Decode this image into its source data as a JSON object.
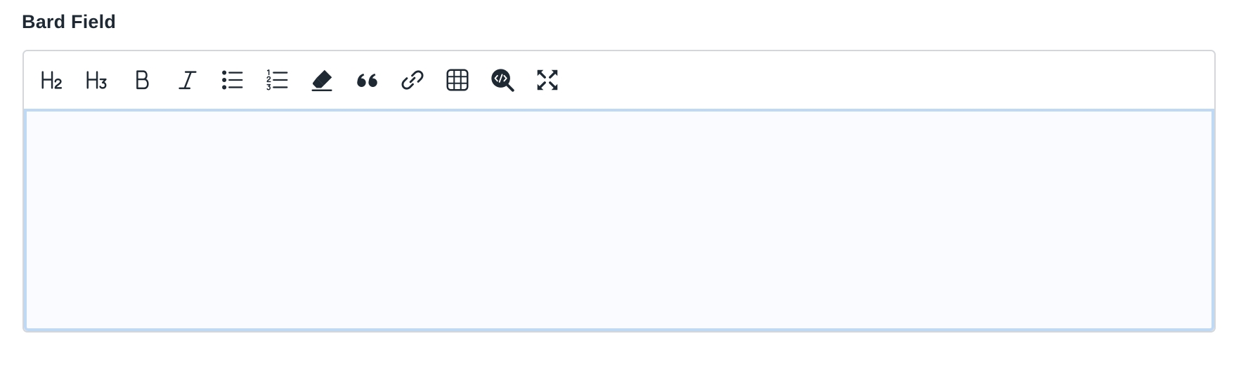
{
  "field": {
    "label": "Bard Field",
    "content": ""
  },
  "toolbar": {
    "buttons": [
      {
        "name": "heading-2",
        "icon": "h2-icon"
      },
      {
        "name": "heading-3",
        "icon": "h3-icon"
      },
      {
        "name": "bold",
        "icon": "bold-icon"
      },
      {
        "name": "italic",
        "icon": "italic-icon"
      },
      {
        "name": "unordered-list",
        "icon": "bullet-list-icon"
      },
      {
        "name": "ordered-list",
        "icon": "numbered-list-icon"
      },
      {
        "name": "remove-format",
        "icon": "eraser-icon"
      },
      {
        "name": "blockquote",
        "icon": "quote-icon"
      },
      {
        "name": "link",
        "icon": "link-icon"
      },
      {
        "name": "table",
        "icon": "table-icon"
      },
      {
        "name": "view-source",
        "icon": "code-search-icon"
      },
      {
        "name": "fullscreen",
        "icon": "expand-icon"
      }
    ]
  },
  "colors": {
    "text": "#1f2933",
    "border": "#d3d6da",
    "focus_border": "#bfd8f3",
    "content_bg": "#f9fbfe"
  }
}
